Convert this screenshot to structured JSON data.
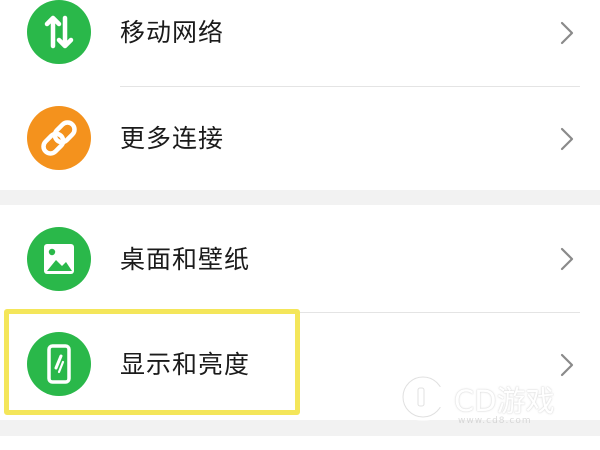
{
  "settings": {
    "items": [
      {
        "label": "移动网络",
        "icon": "mobile-data-arrows-icon",
        "color": "#2ab84a"
      },
      {
        "label": "更多连接",
        "icon": "link-chain-icon",
        "color": "#f4921d"
      },
      {
        "label": "桌面和壁纸",
        "icon": "image-wallpaper-icon",
        "color": "#2ab84a"
      },
      {
        "label": "显示和亮度",
        "icon": "phone-brightness-icon",
        "color": "#2ab84a"
      }
    ]
  },
  "highlight": {
    "color": "#f4e65a"
  },
  "watermark": {
    "text": "CD游戏",
    "url": "www.cd8.com"
  }
}
